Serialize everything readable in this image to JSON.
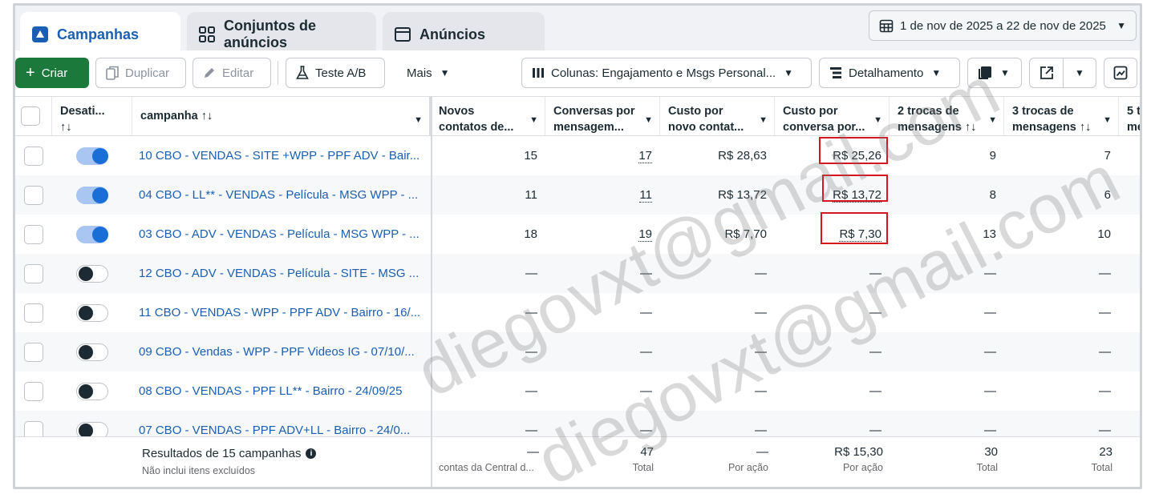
{
  "tabs": [
    {
      "label": "Campanhas",
      "icon": "campaign-flag-icon"
    },
    {
      "label": "Conjuntos de anúncios",
      "icon": "grid-icon"
    },
    {
      "label": "Anúncios",
      "icon": "ad-window-icon"
    }
  ],
  "date_range": "1 de nov de 2025 a 22 de nov de 2025",
  "toolbar": {
    "create": "Criar",
    "duplicate": "Duplicar",
    "edit": "Editar",
    "ab_test": "Teste A/B",
    "more": "Mais",
    "columns": "Colunas: Engajamento e Msgs Personal...",
    "breakdown": "Detalhamento"
  },
  "columns": {
    "toggle": [
      "Desati...",
      "↑↓"
    ],
    "campaign": "campanha ↑↓",
    "new_contacts": [
      "Novos",
      "contatos de..."
    ],
    "conversations": [
      "Conversas por",
      "mensagem..."
    ],
    "cost_new_contact": [
      "Custo por",
      "novo contat..."
    ],
    "cost_conversation": [
      "Custo por",
      "conversa por..."
    ],
    "two_exchanges": [
      "2 trocas de",
      "mensagens ↑↓"
    ],
    "three_exchanges": [
      "3 trocas de",
      "mensagens ↑↓"
    ],
    "five_exchanges": [
      "5 t",
      "me"
    ]
  },
  "rows": [
    {
      "on": true,
      "name": "10 CBO - VENDAS - SITE +WPP - PPF ADV - Bair...",
      "new_contacts": "15",
      "conversations": "17",
      "cost_new": "R$ 28,63",
      "cost_conv": "R$ 25,26",
      "two": "9",
      "three": "7"
    },
    {
      "on": true,
      "name": "04 CBO - LL** - VENDAS - Película - MSG WPP - ...",
      "new_contacts": "11",
      "conversations": "11",
      "cost_new": "R$ 13,72",
      "cost_conv": "R$ 13,72",
      "two": "8",
      "three": "6"
    },
    {
      "on": true,
      "name": "03 CBO - ADV - VENDAS - Película - MSG WPP - ...",
      "new_contacts": "18",
      "conversations": "19",
      "cost_new": "R$ 7,70",
      "cost_conv": "R$ 7,30",
      "two": "13",
      "three": "10"
    },
    {
      "on": false,
      "name": "12 CBO - ADV - VENDAS - Película - SITE - MSG ...",
      "new_contacts": "—",
      "conversations": "—",
      "cost_new": "—",
      "cost_conv": "—",
      "two": "—",
      "three": "—"
    },
    {
      "on": false,
      "name": "11 CBO - VENDAS - WPP - PPF ADV - Bairro - 16/...",
      "new_contacts": "—",
      "conversations": "—",
      "cost_new": "—",
      "cost_conv": "—",
      "two": "—",
      "three": "—"
    },
    {
      "on": false,
      "name": "09 CBO - Vendas - WPP - PPF Videos IG - 07/10/...",
      "new_contacts": "—",
      "conversations": "—",
      "cost_new": "—",
      "cost_conv": "—",
      "two": "—",
      "three": "—"
    },
    {
      "on": false,
      "name": "08 CBO - VENDAS - PPF LL** - Bairro - 24/09/25",
      "new_contacts": "—",
      "conversations": "—",
      "cost_new": "—",
      "cost_conv": "—",
      "two": "—",
      "three": "—"
    },
    {
      "on": false,
      "name": "07 CBO - VENDAS - PPF ADV+LL - Bairro - 24/0...",
      "new_contacts": "—",
      "conversations": "—",
      "cost_new": "—",
      "cost_conv": "—",
      "two": "—",
      "three": "—"
    }
  ],
  "footer": {
    "summary": "Resultados de 15 campanhas",
    "summary_sub": "Não inclui itens excluídos",
    "new_contacts": {
      "value": "—",
      "sub": "contas da Central d..."
    },
    "conversations": {
      "value": "47",
      "sub": "Total"
    },
    "cost_new": {
      "value": "—",
      "sub": "Por ação"
    },
    "cost_conv": {
      "value": "R$ 15,30",
      "sub": "Por ação"
    },
    "two": {
      "value": "30",
      "sub": "Total"
    },
    "three": {
      "value": "23",
      "sub": "Total"
    }
  },
  "watermark": "diegovxt@gmail.com",
  "colors": {
    "accent": "#1a5fb4",
    "create_button": "#1b7a3b",
    "highlight_box": "#d8161f"
  }
}
